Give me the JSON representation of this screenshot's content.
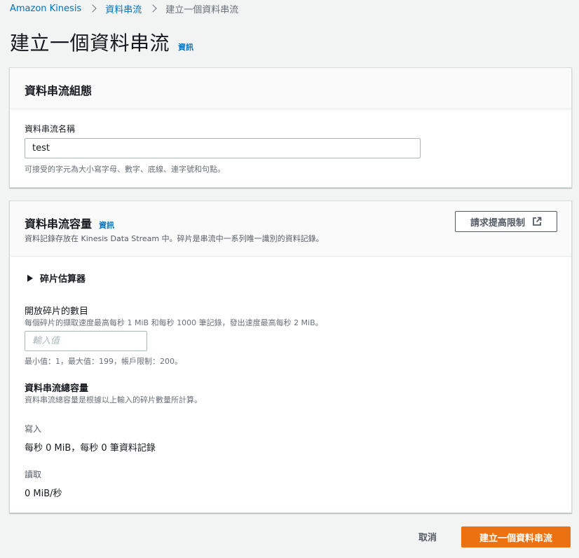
{
  "breadcrumb": {
    "items": [
      "Amazon Kinesis",
      "資料串流",
      "建立一個資料串流"
    ]
  },
  "page": {
    "title": "建立一個資料串流",
    "info_link": "資訊"
  },
  "config_panel": {
    "title": "資料串流組態",
    "name_label": "資料串流名稱",
    "name_value": "test",
    "name_hint": "可接受的字元為大小寫字母、數字、底線、連字號和句點。"
  },
  "capacity_panel": {
    "title": "資料串流容量",
    "info_link": "資訊",
    "description": "資料記錄存放在 Kinesis Data Stream 中。碎片是串流中一系列唯一識別的資料記錄。",
    "limit_button": "請求提高限制",
    "estimator_label": "碎片估算器",
    "shards_label": "開放碎片的數目",
    "shards_desc": "每個碎片的擷取速度最高每秒 1 MiB 和每秒 1000 筆記錄，發出速度最高每秒 2 MiB。",
    "shards_placeholder": "輸入值",
    "shards_hint": "最小值：1，最大值：199，帳戶限制：200。",
    "total_title": "資料串流總容量",
    "total_desc": "資料串流總容量是根據以上輸入的碎片數量所計算。",
    "write_label": "寫入",
    "write_value": "每秒 0 MiB，每秒 0 筆資料記錄",
    "read_label": "讀取",
    "read_value": "0 MiB/秒"
  },
  "footer": {
    "cancel": "取消",
    "create": "建立一個資料串流"
  },
  "colors": {
    "link": "#0073bb",
    "primary": "#ec7211",
    "background": "#f2f3f3"
  }
}
